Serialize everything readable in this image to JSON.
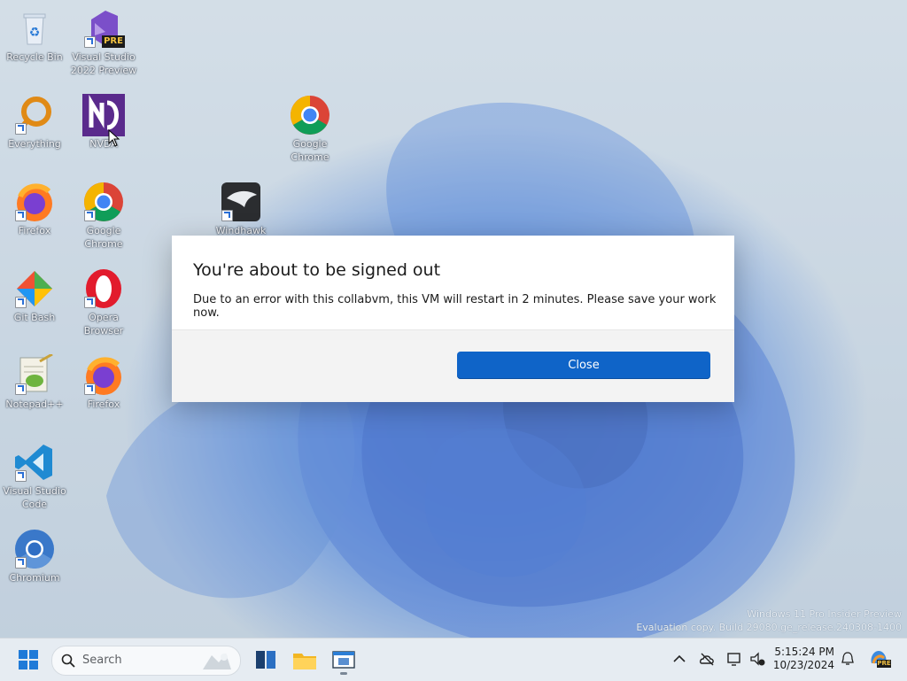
{
  "desktop": {
    "icons": [
      {
        "label_lines": [
          "Recycle Bin"
        ]
      },
      {
        "label_lines": [
          "Visual Studio",
          "2022 Preview"
        ],
        "badge": "PRE"
      },
      {
        "label_lines": [
          "Everything"
        ]
      },
      {
        "label_lines": [
          "NVDA"
        ]
      },
      {
        "label_lines": [
          "Google",
          "Chrome"
        ]
      },
      {
        "label_lines": [
          "Firefox"
        ]
      },
      {
        "label_lines": [
          "Google",
          "Chrome"
        ]
      },
      {
        "label_lines": [
          "Windhawk"
        ]
      },
      {
        "label_lines": [
          "Git Bash"
        ]
      },
      {
        "label_lines": [
          "Opera",
          "Browser"
        ]
      },
      {
        "label_lines": [
          "Notepad++"
        ]
      },
      {
        "label_lines": [
          "Firefox"
        ]
      },
      {
        "label_lines": [
          "Visual Studio",
          "Code"
        ]
      },
      {
        "label_lines": [
          "Chromium"
        ]
      }
    ],
    "watermark": {
      "line1": "Windows 11 Pro Insider Preview",
      "line2": "Evaluation copy. Build 29080.ge_release.240308-1400"
    }
  },
  "dialog": {
    "title": "You're about to be signed out",
    "message": "Due to an error with this collabvm, this VM will restart in 2 minutes. Please save your work now.",
    "close_label": "Close",
    "accent": "#0f64c8"
  },
  "taskbar": {
    "search_placeholder": "Search",
    "time": "5:15:24 PM",
    "date": "10/23/2024",
    "copilot_badge": "PRE"
  },
  "icons": [
    "start-icon",
    "search-icon",
    "task-view-icon",
    "file-explorer-icon",
    "app-window-icon",
    "chevron-up-icon",
    "onedrive-icon",
    "network-icon",
    "volume-icon",
    "bell-icon",
    "copilot-icon"
  ]
}
